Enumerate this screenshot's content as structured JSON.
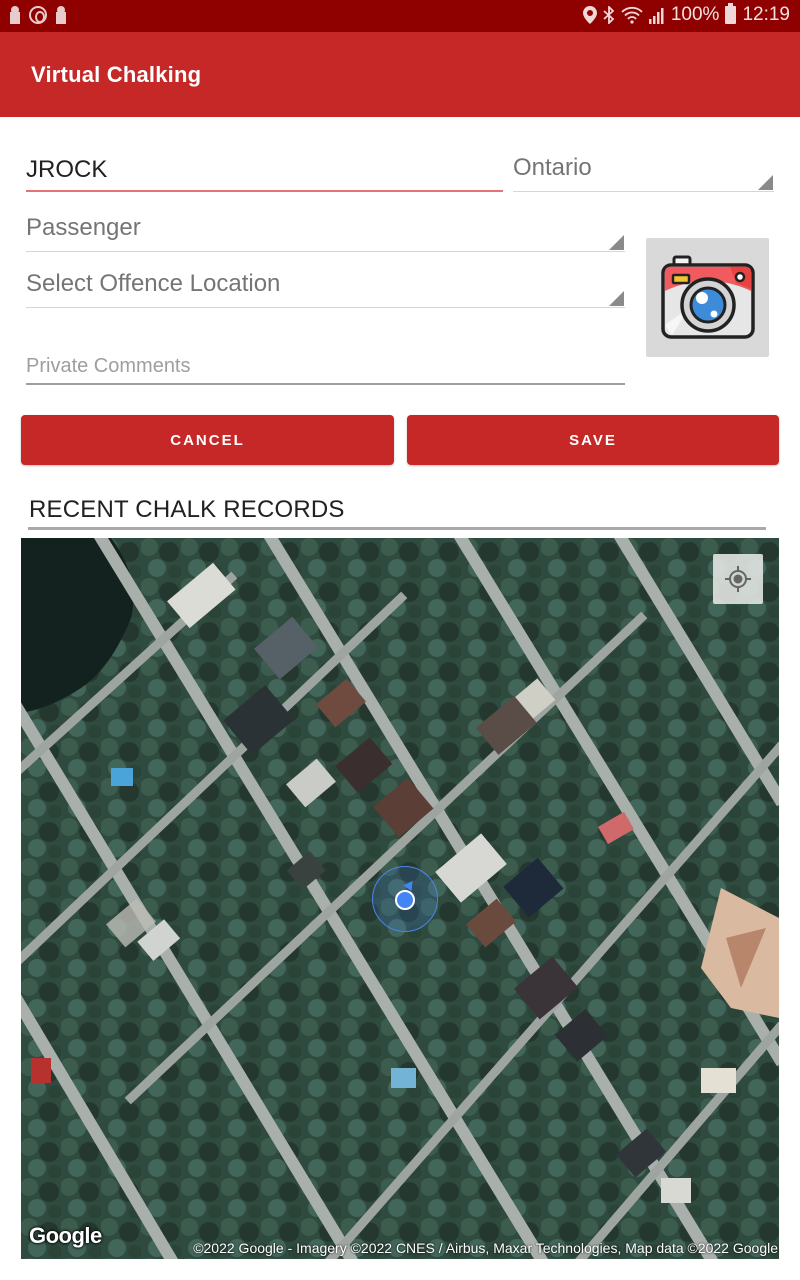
{
  "status_bar": {
    "left_icons": [
      "keyhole-icon",
      "power-ring-icon",
      "keyhole-icon"
    ],
    "right_icons": [
      "location-pin-icon",
      "bluetooth-icon",
      "wifi-icon",
      "cell-signal-icon"
    ],
    "battery_percent": "100%",
    "time": "12:19"
  },
  "app_bar": {
    "title": "Virtual Chalking"
  },
  "form": {
    "plate": {
      "value": "JROCK"
    },
    "province": {
      "selected": "Ontario"
    },
    "plate_type": {
      "selected": "Passenger"
    },
    "offence_location": {
      "selected": "Select Offence Location"
    },
    "private_comments": {
      "placeholder": "Private Comments",
      "value": ""
    },
    "camera_button": {
      "icon": "camera-icon"
    }
  },
  "actions": {
    "cancel_label": "CANCEL",
    "save_label": "SAVE"
  },
  "recent": {
    "title": "RECENT CHALK RECORDS"
  },
  "map": {
    "type": "satellite",
    "locate_icon": "my-location-icon",
    "logo": "Google",
    "attribution": "©2022 Google - Imagery ©2022 CNES / Airbus, Maxar Technologies, Map data ©2022 Google"
  },
  "colors": {
    "status_bar": "#8f0000",
    "primary": "#c62828",
    "accent_underline": "#e57373",
    "location_blue": "#4285f4"
  }
}
